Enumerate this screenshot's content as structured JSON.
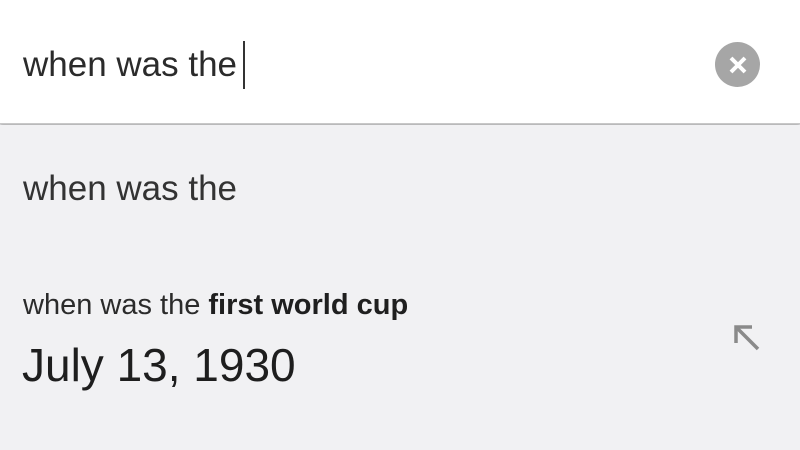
{
  "search": {
    "query": "when was the"
  },
  "suggestions": {
    "plain": "when was the",
    "answer": {
      "query_prefix": "when was the",
      "query_completion": "first world cup",
      "value": "July 13, 1930"
    }
  },
  "icons": {
    "clear": "clear-icon",
    "refine": "arrow-up-left-icon"
  },
  "colors": {
    "search_background": "#ffffff",
    "suggestions_background": "#f1f1f3",
    "clear_button": "#a6a6a6",
    "icon_gray": "#8a8a8a"
  }
}
